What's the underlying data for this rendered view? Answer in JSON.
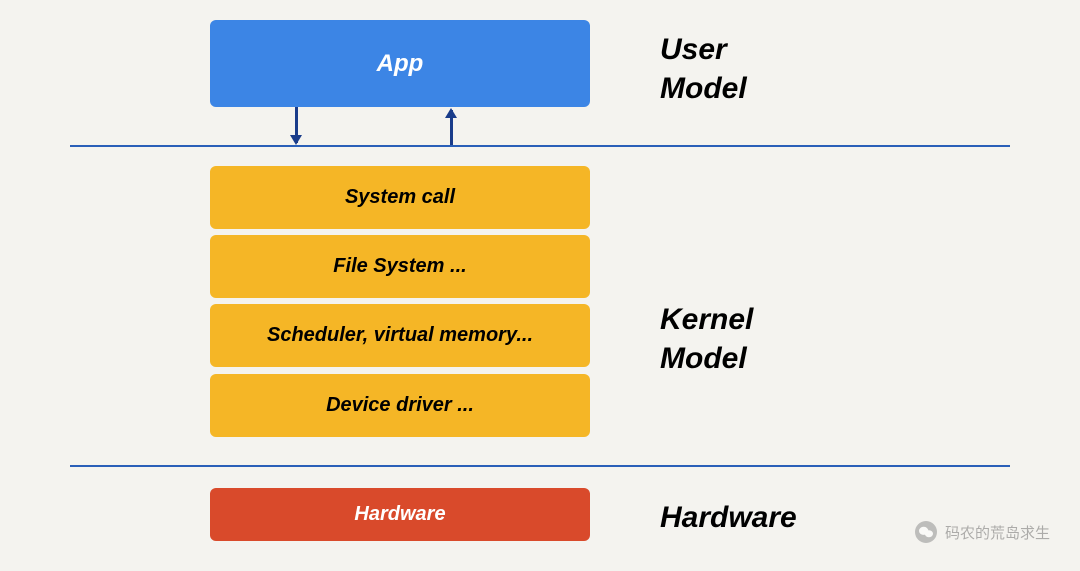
{
  "layers": {
    "user": {
      "app_label": "App",
      "section_label": "User\nModel"
    },
    "kernel": {
      "section_label": "Kernel\nModel",
      "boxes": [
        "System call",
        "File System ...",
        "Scheduler, virtual memory...",
        "Device driver ..."
      ]
    },
    "hardware": {
      "box_label": "Hardware",
      "section_label": "Hardware"
    }
  },
  "watermark": {
    "text": "码农的荒岛求生"
  },
  "colors": {
    "app": "#3c85e5",
    "kernel": "#f5b626",
    "hardware": "#d94a2b",
    "divider": "#2a5fb8",
    "background": "#f4f3ef"
  }
}
